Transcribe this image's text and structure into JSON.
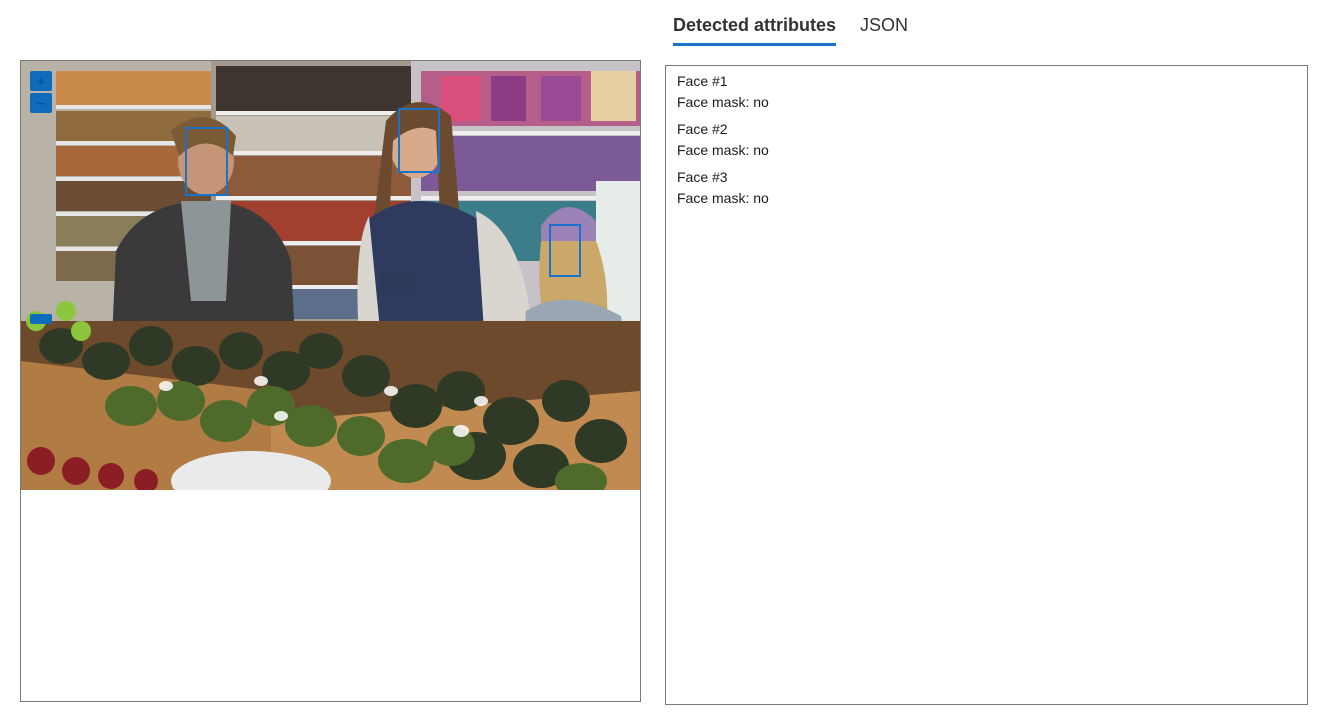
{
  "tabs": [
    {
      "label": "Detected attributes",
      "active": true
    },
    {
      "label": "JSON",
      "active": false
    }
  ],
  "viewer": {
    "zoom_in_icon": "plus-icon",
    "zoom_out_icon": "minus-icon",
    "zoom_in_glyph": "+",
    "zoom_out_glyph": "−",
    "accent_color": "#0f6cbd",
    "box_color": "#1a73c8"
  },
  "faces": [
    {
      "title": "Face #1",
      "mask": "Face mask: no"
    },
    {
      "title": "Face #2",
      "mask": "Face mask: no"
    },
    {
      "title": "Face #3",
      "mask": "Face mask: no"
    }
  ]
}
